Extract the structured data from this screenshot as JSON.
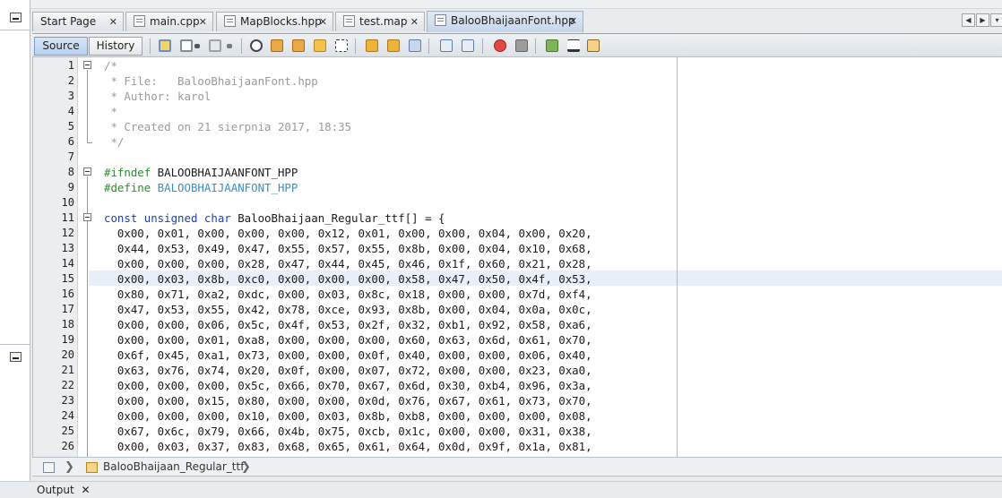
{
  "tabs": [
    {
      "label": "Start Page",
      "active": false
    },
    {
      "label": "main.cpp",
      "active": false
    },
    {
      "label": "MapBlocks.hpp",
      "active": false
    },
    {
      "label": "test.map",
      "active": false
    },
    {
      "label": "BalooBhaijaanFont.hpp",
      "active": true
    }
  ],
  "toolbar": {
    "source_label": "Source",
    "history_label": "History"
  },
  "code": {
    "lines": [
      {
        "n": "1",
        "segs": [
          {
            "t": "/*",
            "c": "comment"
          }
        ]
      },
      {
        "n": "2",
        "segs": [
          {
            "t": " * File:   BalooBhaijaanFont.hpp",
            "c": "comment"
          }
        ]
      },
      {
        "n": "3",
        "segs": [
          {
            "t": " * Author: karol",
            "c": "comment"
          }
        ]
      },
      {
        "n": "4",
        "segs": [
          {
            "t": " *",
            "c": "comment"
          }
        ]
      },
      {
        "n": "5",
        "segs": [
          {
            "t": " * Created on 21 sierpnia 2017, 18:35",
            "c": "comment"
          }
        ]
      },
      {
        "n": "6",
        "segs": [
          {
            "t": " */",
            "c": "comment"
          }
        ]
      },
      {
        "n": "7",
        "segs": []
      },
      {
        "n": "8",
        "segs": [
          {
            "t": "#ifndef",
            "c": "prep"
          },
          {
            "t": " BALOOBHAIJAANFONT_HPP",
            "c": ""
          }
        ]
      },
      {
        "n": "9",
        "segs": [
          {
            "t": "#define",
            "c": "prep"
          },
          {
            "t": " BALOOBHAIJAANFONT_HPP",
            "c": "macro"
          }
        ]
      },
      {
        "n": "10",
        "segs": []
      },
      {
        "n": "11",
        "segs": [
          {
            "t": "const unsigned char",
            "c": "kw"
          },
          {
            "t": " BalooBhaijaan_Regular_ttf[] = {",
            "c": ""
          }
        ]
      },
      {
        "n": "12",
        "segs": [
          {
            "t": "  0x00, 0x01, 0x00, 0x00, 0x00, 0x12, 0x01, 0x00, 0x00, 0x04, 0x00, 0x20,",
            "c": ""
          }
        ]
      },
      {
        "n": "13",
        "segs": [
          {
            "t": "  0x44, 0x53, 0x49, 0x47, 0x55, 0x57, 0x55, 0x8b, 0x00, 0x04, 0x10, 0x68,",
            "c": ""
          }
        ]
      },
      {
        "n": "14",
        "segs": [
          {
            "t": "  0x00, 0x00, 0x00, 0x28, 0x47, 0x44, 0x45, 0x46, 0x1f, 0x60, 0x21, 0x28,",
            "c": ""
          }
        ]
      },
      {
        "n": "15",
        "segs": [
          {
            "t": "  0x00, 0x03, 0x8b, 0xc0, 0x00, 0x00, 0x00, 0x58, 0x47, 0x50, 0x4f, 0x53,",
            "c": ""
          }
        ]
      },
      {
        "n": "16",
        "segs": [
          {
            "t": "  0x80, 0x71, 0xa2, 0xdc, 0x00, 0x03, 0x8c, 0x18, 0x00, 0x00, 0x7d, 0xf4,",
            "c": ""
          }
        ]
      },
      {
        "n": "17",
        "segs": [
          {
            "t": "  0x47, 0x53, 0x55, 0x42, 0x78, 0xce, 0x93, 0x8b, 0x00, 0x04, 0x0a, 0x0c,",
            "c": ""
          }
        ]
      },
      {
        "n": "18",
        "segs": [
          {
            "t": "  0x00, 0x00, 0x06, 0x5c, 0x4f, 0x53, 0x2f, 0x32, 0xb1, 0x92, 0x58, 0xa6,",
            "c": ""
          }
        ]
      },
      {
        "n": "19",
        "segs": [
          {
            "t": "  0x00, 0x00, 0x01, 0xa8, 0x00, 0x00, 0x00, 0x60, 0x63, 0x6d, 0x61, 0x70,",
            "c": ""
          }
        ]
      },
      {
        "n": "20",
        "segs": [
          {
            "t": "  0x6f, 0x45, 0xa1, 0x73, 0x00, 0x00, 0x0f, 0x40, 0x00, 0x00, 0x06, 0x40,",
            "c": ""
          }
        ]
      },
      {
        "n": "21",
        "segs": [
          {
            "t": "  0x63, 0x76, 0x74, 0x20, 0x0f, 0x00, 0x07, 0x72, 0x00, 0x00, 0x23, 0xa0,",
            "c": ""
          }
        ]
      },
      {
        "n": "22",
        "segs": [
          {
            "t": "  0x00, 0x00, 0x00, 0x5c, 0x66, 0x70, 0x67, 0x6d, 0x30, 0xb4, 0x96, 0x3a,",
            "c": ""
          }
        ]
      },
      {
        "n": "23",
        "segs": [
          {
            "t": "  0x00, 0x00, 0x15, 0x80, 0x00, 0x00, 0x0d, 0x76, 0x67, 0x61, 0x73, 0x70,",
            "c": ""
          }
        ]
      },
      {
        "n": "24",
        "segs": [
          {
            "t": "  0x00, 0x00, 0x00, 0x10, 0x00, 0x03, 0x8b, 0xb8, 0x00, 0x00, 0x00, 0x08,",
            "c": ""
          }
        ]
      },
      {
        "n": "25",
        "segs": [
          {
            "t": "  0x67, 0x6c, 0x79, 0x66, 0x4b, 0x75, 0xcb, 0x1c, 0x00, 0x00, 0x31, 0x38,",
            "c": ""
          }
        ]
      },
      {
        "n": "26",
        "segs": [
          {
            "t": "  0x00, 0x03, 0x37, 0x83, 0x68, 0x65, 0x61, 0x64, 0x0d, 0x9f, 0x1a, 0x81,",
            "c": ""
          }
        ]
      }
    ]
  },
  "breadcrumb": {
    "symbol": "BalooBhaijaan_Regular_ttf"
  },
  "output": {
    "label": "Output"
  },
  "colors": {
    "comment": "#9a9a9a",
    "preprocessor": "#2e8b2e",
    "macro": "#3a8fc7",
    "keyword": "#1b3fb5",
    "current_line": "#e9eff8"
  }
}
